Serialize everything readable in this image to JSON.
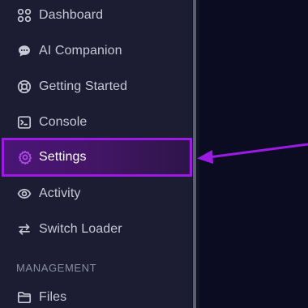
{
  "sidebar": {
    "items": [
      {
        "label": "Dashboard",
        "icon": "dashboard-grid-icon"
      },
      {
        "label": "AI Companion",
        "icon": "chat-bubble-icon"
      },
      {
        "label": "Getting Started",
        "icon": "lifebuoy-icon"
      },
      {
        "label": "Console",
        "icon": "terminal-icon"
      },
      {
        "label": "Settings",
        "icon": "gear-icon",
        "active": true
      },
      {
        "label": "Activity",
        "icon": "eye-icon"
      },
      {
        "label": "Switch Loader",
        "icon": "swap-arrows-icon"
      }
    ],
    "section_management": "MANAGEMENT",
    "management_items": [
      {
        "label": "Files",
        "icon": "folder-icon"
      }
    ]
  },
  "colors": {
    "highlight_border": "#9b1be3",
    "annotation_arrow": "#9b1be3",
    "sidebar_bg": "#1c1c33",
    "main_bg": "#0b0b21"
  }
}
